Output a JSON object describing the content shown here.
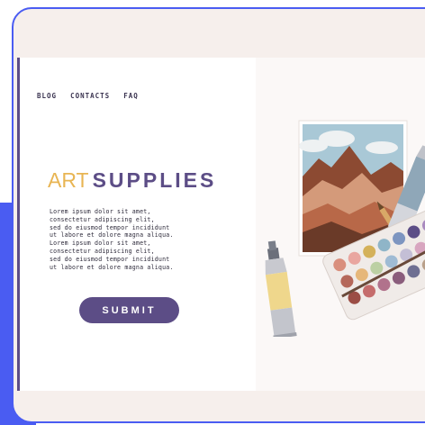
{
  "nav": {
    "items": [
      {
        "label": "BLOG"
      },
      {
        "label": "CONTACTS"
      },
      {
        "label": "FAQ"
      }
    ]
  },
  "hero": {
    "title_part1": "ART",
    "title_part2": "SUPPLIES",
    "body": "Lorem ipsum dolor sit amet,\nconsectetur adipiscing elit,\nsed do eiusmod tempor incididunt\nut labore et dolore magna aliqua.\nLorem ipsum dolor sit amet,\nconsectetur adipiscing elit,\nsed do eiusmod tempor incididunt\nut labore et dolore magna aliqua.",
    "submit_label": "SUBMIT"
  },
  "colors": {
    "accent_purple": "#5c4d86",
    "accent_yellow": "#e8b553",
    "frame_blue": "#4a5cf2",
    "window_bg": "#f6efec"
  },
  "icons": [
    "paint-tube-icon",
    "paint-tube-icon",
    "painting-canvas-icon",
    "pencil-icon",
    "watercolor-palette-icon"
  ]
}
